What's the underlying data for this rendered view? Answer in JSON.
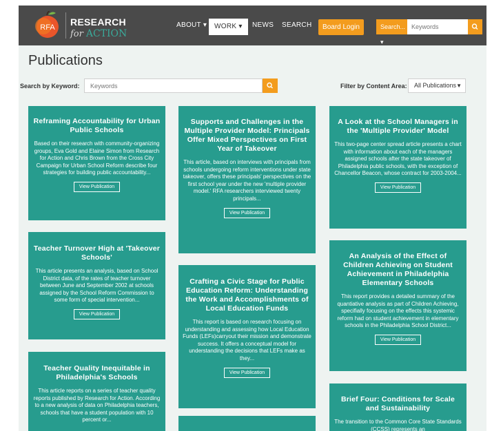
{
  "brand": {
    "line1": "RESEARCH",
    "line2_for": "for",
    "line2_action": "ACTION",
    "logo_text": "RFA",
    "colors": {
      "navbar": "#4a4a4a",
      "teal": "#279c8e",
      "orange": "#f39c1e"
    }
  },
  "nav": {
    "items": [
      {
        "label": "ABOUT ▾"
      },
      {
        "label": "WORK ▾"
      },
      {
        "label": "NEWS"
      },
      {
        "label": "SEARCH"
      }
    ],
    "login_label": "Board Login",
    "search_dropdown": "Search... ▾",
    "search_placeholder": "Keywords",
    "search_icon": "search-icon"
  },
  "page": {
    "title": "Publications",
    "keyword_label": "Search by Keyword:",
    "keyword_placeholder": "Keywords",
    "filter_label": "Filter by Content Area:",
    "filter_value": "All Publications"
  },
  "cards": [
    {
      "title": "Reframing Accountability for Urban Public Schools",
      "text": "Based on their research with community-organizing groups, Eva Gold and Elaine Simon from Research for Action and Chris Brown from the Cross City Campaign for Urban School Reform describe four strategies for building public accountability...",
      "button": "View Publication"
    },
    {
      "title": "Supports and Challenges in the Multiple Provider Model: Principals Offer Mixed Perspectives on First Year of Takeover",
      "text": "This article, based on interviews with principals from schools undergoing reform interventions under state takeover, offers these principals' perspectives on the first school year under the new 'multiple provider model.' RFA researchers interviewed twenty principals...",
      "button": "View Publication"
    },
    {
      "title": "A Look at the School Managers in the 'Multiple Provider' Model",
      "text": "This two-page center spread article presents a chart with information about each of the managers assigned schools after the state takeover of Philadelphia public schools, with the exception of Chancellor Beacon, whose contract for 2003-2004...",
      "button": "View Publication"
    },
    {
      "title": "Teacher Turnover High at 'Takeover Schools'",
      "text": "This article presents an analysis, based on School District data, of the rates of teacher turnover between June and September 2002 at schools assigned by the School Reform Commission to some form of special intervention...",
      "button": "View Publication"
    },
    {
      "title": "Crafting a Civic Stage for Public Education Reform: Understanding the Work and Accomplishments of Local Education Funds",
      "text": "This report is based on research focusing on understanding and assessing how Local Education Funds (LEFs)carryout their mission and demonstrate success. It offers a conceptual model for understanding the decisions that LEFs make as they...",
      "button": "View Publication"
    },
    {
      "title": "An Analysis of the Effect of Children Achieving on Student Achievement in Philadelphia Elementary Schools",
      "text": "This report provides a detailed summary of the quantiative analysis as part of Children Achieving, specifially focusing on the effects this systemic reform had on student achievement in elementary schools in the Philadelphia School District...",
      "button": "View Publication"
    },
    {
      "title": "Teacher Quality Inequitable in Philadelphia's Schools",
      "text": "This article reports on a series of teacher quality reports published by Research for Action. According to a new analysis of data on Philadelphia teachers, schools that have a student population with 10 percent or...",
      "button": ""
    },
    {
      "title": "Brief Four: Conditions for Scale and Sustainability",
      "text": "The transition to the Common Core State Standards (CCSS) represents an",
      "button": ""
    }
  ]
}
